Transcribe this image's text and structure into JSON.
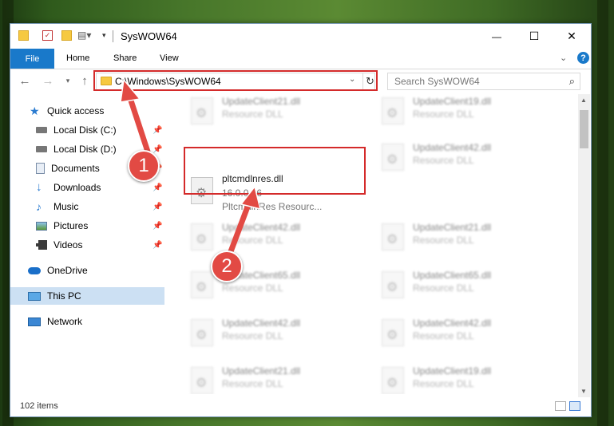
{
  "window": {
    "title": "SysWOW64",
    "controls": {
      "minimize": "—",
      "maximize": "☐",
      "close": "✕"
    }
  },
  "ribbon": {
    "tabs": [
      "File",
      "Home",
      "Share",
      "View"
    ],
    "help": "?"
  },
  "navigation": {
    "address": "C:\\Windows\\SysWOW64",
    "search_placeholder": "Search SysWOW64"
  },
  "sidebar": {
    "items": [
      {
        "label": "Quick access",
        "icon": "star-icon",
        "pinned": false
      },
      {
        "label": "Local Disk (C:)",
        "icon": "drive-icon",
        "pinned": true
      },
      {
        "label": "Local Disk (D:)",
        "icon": "drive-icon",
        "pinned": true
      },
      {
        "label": "Documents",
        "icon": "documents-icon",
        "pinned": true
      },
      {
        "label": "Downloads",
        "icon": "download-icon",
        "pinned": true
      },
      {
        "label": "Music",
        "icon": "music-icon",
        "pinned": true
      },
      {
        "label": "Pictures",
        "icon": "pictures-icon",
        "pinned": true
      },
      {
        "label": "Videos",
        "icon": "videos-icon",
        "pinned": true
      },
      {
        "label": "OneDrive",
        "icon": "cloud-icon",
        "pinned": false
      },
      {
        "label": "This PC",
        "icon": "computer-icon",
        "pinned": false,
        "selected": true
      },
      {
        "label": "Network",
        "icon": "network-icon",
        "pinned": false
      }
    ]
  },
  "files": {
    "highlighted": {
      "name": "pltcmdlnres.dll",
      "version": "16.0.0.86",
      "description": "PltcmdlnRes Resourc..."
    },
    "left_column": [
      {
        "name": "UpdateClient21.dll",
        "type": "Resource DLL"
      },
      {
        "name": "UpdateClient42.dll",
        "type": "Resource DLL"
      },
      {
        "name": "UpdateClient65.dll",
        "type": "Resource DLL"
      },
      {
        "name": "UpdateClient42.dll",
        "type": "Resource DLL"
      },
      {
        "name": "UpdateClient21.dll",
        "type": "Resource DLL"
      }
    ],
    "right_column": [
      {
        "name": "UpdateClient19.dll",
        "type": "Resource DLL"
      },
      {
        "name": "UpdateClient42.dll",
        "type": "Resource DLL"
      },
      {
        "name": "UpdateClient21.dll",
        "type": "Resource DLL"
      },
      {
        "name": "UpdateClient65.dll",
        "type": "Resource DLL"
      },
      {
        "name": "UpdateClient42.dll",
        "type": "Resource DLL"
      },
      {
        "name": "UpdateClient19.dll",
        "type": "Resource DLL"
      }
    ]
  },
  "status": {
    "item_count": "102 items"
  },
  "annotations": {
    "badge_1": "1",
    "badge_2": "2",
    "color": "#e24a44"
  },
  "colors": {
    "accent": "#1979ca",
    "highlight_box": "#d42a2a",
    "selection": "#cce0f3"
  }
}
